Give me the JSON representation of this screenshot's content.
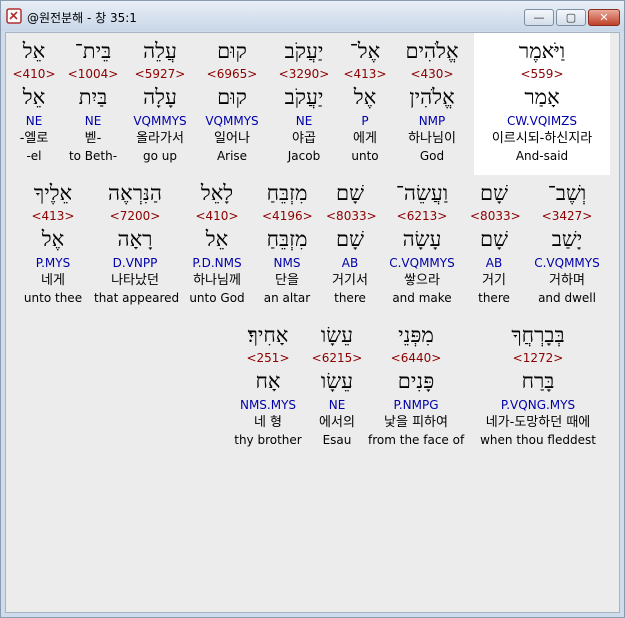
{
  "window": {
    "title": "@원전분해 - 창 35:1",
    "controls": {
      "minimize": "—",
      "maximize": "▢",
      "close": "✕"
    }
  },
  "rows": [
    {
      "words": [
        {
          "heb": "אֵל",
          "strong": "<410>",
          "lemma": "אֵל",
          "morph": "NE",
          "kor": "-엘로",
          "eng": "-el",
          "highlight": false
        },
        {
          "heb": "בֵּית־",
          "strong": "<1004>",
          "lemma": "בַּיִת",
          "morph": "NE",
          "kor": "벧-",
          "eng": "to Beth-",
          "highlight": false
        },
        {
          "heb": "עֲלֵה",
          "strong": "<5927>",
          "lemma": "עָלָה",
          "morph": "VQMMYS",
          "kor": "올라가서",
          "eng": "go up",
          "highlight": false
        },
        {
          "heb": "קוּם",
          "strong": "<6965>",
          "lemma": "קוּם",
          "morph": "VQMMYS",
          "kor": "일어나",
          "eng": "Arise",
          "highlight": false
        },
        {
          "heb": "יַעֲקֹב",
          "strong": "<3290>",
          "lemma": "יַעֲקֹב",
          "morph": "NE",
          "kor": "야곱",
          "eng": "Jacob",
          "highlight": false
        },
        {
          "heb": "אֶל־",
          "strong": "<413>",
          "lemma": "אֶל",
          "morph": "P",
          "kor": "에게",
          "eng": "unto",
          "highlight": false
        },
        {
          "heb": "אֱלֹהִים",
          "strong": "<430>",
          "lemma": "אֱלֹהִין",
          "morph": "NMP",
          "kor": "하나님이",
          "eng": "God",
          "highlight": false
        },
        {
          "heb": "וַיֹּאמֶר",
          "strong": "<559>",
          "lemma": "אָמַר",
          "morph": "CW.VQIMZS",
          "kor": "이르시되-하신지라",
          "eng": "And-said",
          "highlight": true
        }
      ]
    },
    {
      "words": [
        {
          "heb": "אֵלֶיךָ",
          "strong": "<413>",
          "lemma": "אֶל",
          "morph": "P.MYS",
          "kor": "네게",
          "eng": "unto thee",
          "highlight": false
        },
        {
          "heb": "הַנִּרְאֶה",
          "strong": "<7200>",
          "lemma": "רָאָה",
          "morph": "D.VNPP",
          "kor": "나타났던",
          "eng": "that appeared",
          "highlight": false
        },
        {
          "heb": "לָאֵל",
          "strong": "<410>",
          "lemma": "אֵל",
          "morph": "P.D.NMS",
          "kor": "하나님께",
          "eng": "unto God",
          "highlight": false
        },
        {
          "heb": "מִזְבֵּחַ",
          "strong": "<4196>",
          "lemma": "מִזְבֵּחַ",
          "morph": "NMS",
          "kor": "단을",
          "eng": "an altar",
          "highlight": false
        },
        {
          "heb": "שָׁם",
          "strong": "<8033>",
          "lemma": "שָׁם",
          "morph": "AB",
          "kor": "거기서",
          "eng": "there",
          "highlight": false
        },
        {
          "heb": "וַעֲשֵׂה־",
          "strong": "<6213>",
          "lemma": "עָשָׂה",
          "morph": "C.VQMMYS",
          "kor": "쌓으라",
          "eng": "and make",
          "highlight": false
        },
        {
          "heb": "שָׁם",
          "strong": "<8033>",
          "lemma": "שָׁם",
          "morph": "AB",
          "kor": "거기",
          "eng": "there",
          "highlight": false
        },
        {
          "heb": "וְשֶׁב־",
          "strong": "<3427>",
          "lemma": "יָשַׁב",
          "morph": "C.VQMMYS",
          "kor": "거하며",
          "eng": "and dwell",
          "highlight": false
        }
      ]
    },
    {
      "words": [
        {
          "heb": "אָחִיךָ׃",
          "strong": "<251>",
          "lemma": "אָח",
          "morph": "NMS.MYS",
          "kor": "네 형",
          "eng": "thy brother",
          "highlight": false
        },
        {
          "heb": "עֵשָׂו",
          "strong": "<6215>",
          "lemma": "עֵשָׂו",
          "morph": "NE",
          "kor": "에서의",
          "eng": "Esau",
          "highlight": false
        },
        {
          "heb": "מִפְּנֵי",
          "strong": "<6440>",
          "lemma": "פָּנִים",
          "morph": "P.NMPG",
          "kor": "낯을 피하여",
          "eng": "from the face of",
          "highlight": false
        },
        {
          "heb": "בְּבָרְחֲךָ",
          "strong": "<1272>",
          "lemma": "בָּרַח",
          "morph": "P.VQNG.MYS",
          "kor": "네가-도망하던 때에",
          "eng": "when thou fleddest",
          "highlight": false
        }
      ]
    }
  ]
}
